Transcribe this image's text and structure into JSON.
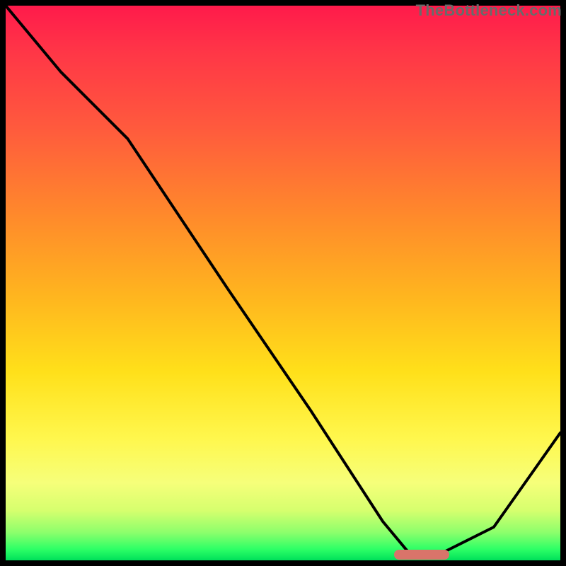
{
  "watermark": "TheBottleneck.com",
  "colors": {
    "frame": "#000000",
    "curve": "#000000",
    "marker": "#d9746a",
    "gradient_top": "#ff1a4b",
    "gradient_bottom": "#00e05a"
  },
  "chart_data": {
    "type": "line",
    "title": "",
    "xlabel": "",
    "ylabel": "",
    "xlim": [
      0,
      100
    ],
    "ylim": [
      0,
      100
    ],
    "grid": false,
    "x": [
      0,
      10,
      22,
      40,
      55,
      68,
      73,
      78,
      88,
      100
    ],
    "values": [
      100,
      88,
      76,
      49,
      27,
      7,
      1,
      1,
      6,
      23
    ],
    "marker": {
      "x_start": 70,
      "x_end": 80,
      "y": 1
    },
    "notes": "Background gradient: red (top, high value) → green (bottom, low value). Curve shows bottleneck-style V shape with flat minimum around x≈73–78."
  }
}
